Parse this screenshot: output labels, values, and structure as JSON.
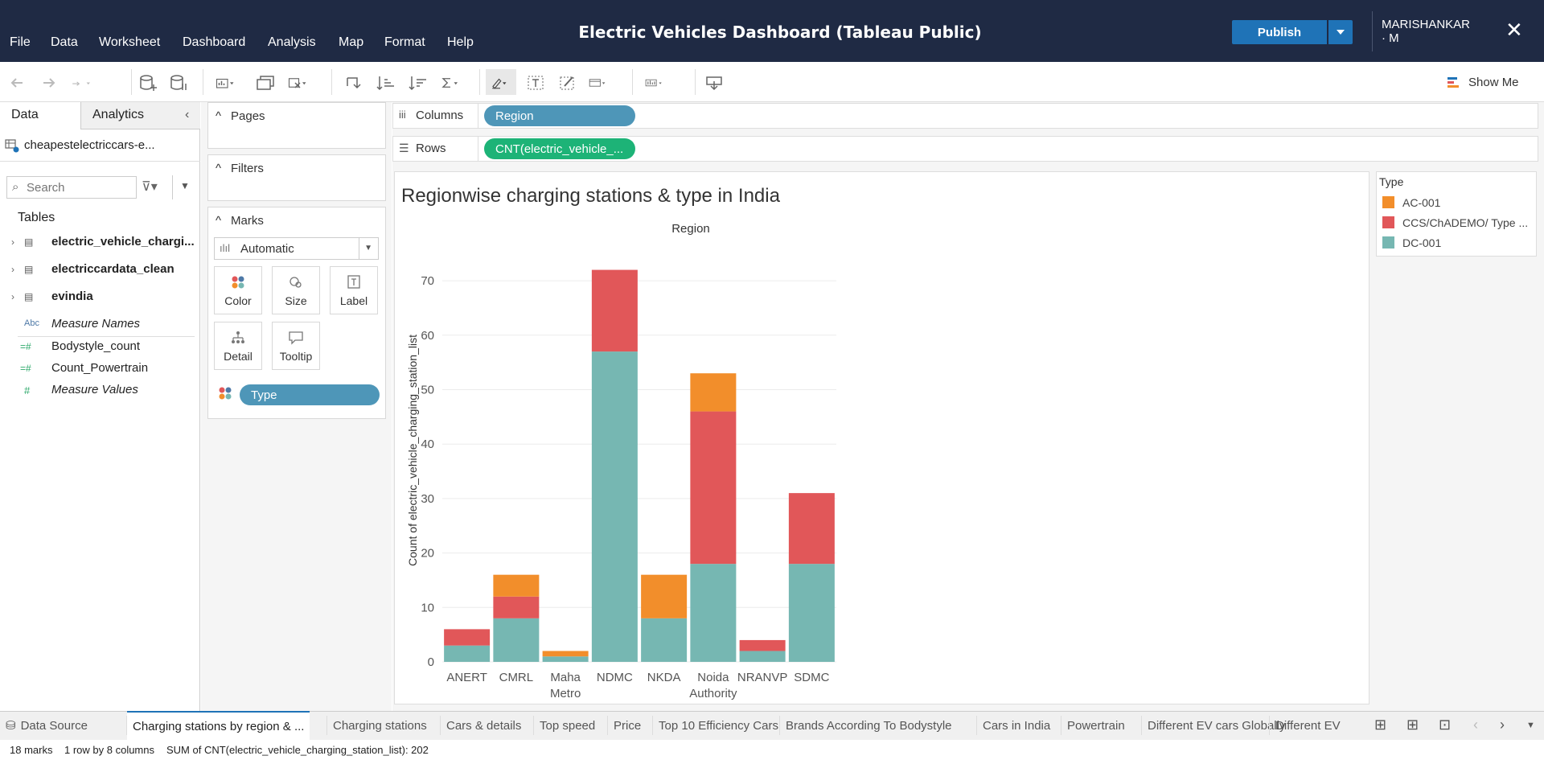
{
  "app": {
    "title": "Electric Vehicles Dashboard (Tableau Public)",
    "menu": [
      "File",
      "Data",
      "Worksheet",
      "Dashboard",
      "Analysis",
      "Map",
      "Format",
      "Help"
    ],
    "publish_label": "Publish",
    "user": "MARISHANKAR · M",
    "close": "✕"
  },
  "toolbar": {
    "show_me": "Show Me"
  },
  "left": {
    "tabs": [
      "Data",
      "Analytics"
    ],
    "datasource": "cheapestelectriccars-e...",
    "search_placeholder": "Search",
    "tables_label": "Tables",
    "tables": [
      "electric_vehicle_chargi...",
      "electriccardata_clean",
      "evindia"
    ],
    "fields": [
      {
        "icon": "Abc",
        "name": "Measure Names"
      },
      {
        "icon": "=#",
        "name": "Bodystyle_count"
      },
      {
        "icon": "=#",
        "name": "Count_Powertrain"
      },
      {
        "icon": "#",
        "name": "Measure Values"
      }
    ]
  },
  "cards": {
    "pages": "Pages",
    "filters": "Filters",
    "marks": "Marks",
    "mark_type": "Automatic",
    "buttons": [
      "Color",
      "Size",
      "Label",
      "Detail",
      "Tooltip"
    ],
    "color_pill": "Type"
  },
  "shelves": {
    "columns_label": "Columns",
    "columns_pill": "Region",
    "rows_label": "Rows",
    "rows_pill": "CNT(electric_vehicle_..."
  },
  "legend": {
    "title": "Type",
    "items": [
      {
        "label": "AC-001",
        "color": "#f28e2b"
      },
      {
        "label": "CCS/ChADEMO/ Type ...",
        "color": "#e15759"
      },
      {
        "label": "DC-001",
        "color": "#76b7b2"
      }
    ]
  },
  "chart_data": {
    "type": "bar",
    "stacked": true,
    "title": "Regionwise charging stations & type in India",
    "xlabel": "Region",
    "ylabel": "Count of electric_vehicle_charging_station_list",
    "categories": [
      "ANERT",
      "CMRL",
      "Maha Metro",
      "NDMC",
      "NKDA",
      "Noida Authority",
      "NRANVP",
      "SDMC"
    ],
    "series": [
      {
        "name": "DC-001",
        "color": "#76b7b2",
        "values": [
          3,
          8,
          1,
          57,
          8,
          18,
          2,
          18
        ]
      },
      {
        "name": "CCS/ChADEMO/ Type ...",
        "color": "#e15759",
        "values": [
          3,
          4,
          0,
          15,
          0,
          28,
          2,
          13
        ]
      },
      {
        "name": "AC-001",
        "color": "#f28e2b",
        "values": [
          0,
          4,
          1,
          0,
          8,
          7,
          0,
          0
        ]
      }
    ],
    "yticks": [
      0,
      10,
      20,
      30,
      40,
      50,
      60,
      70
    ],
    "ylim": [
      0,
      78
    ],
    "grid": true
  },
  "bottom_tabs": [
    "Data Source",
    "Charging stations by region & ...",
    "Charging stations",
    "Cars & details",
    "Top speed",
    "Price",
    "Top 10 Efficiency Cars",
    "Brands According To Bodystyle",
    "Cars in India",
    "Powertrain",
    "Different EV cars Globally",
    "Different EV"
  ],
  "status": {
    "marks": "18 marks",
    "dims": "1 row by 8 columns",
    "sum": "SUM of CNT(electric_vehicle_charging_station_list): 202"
  }
}
